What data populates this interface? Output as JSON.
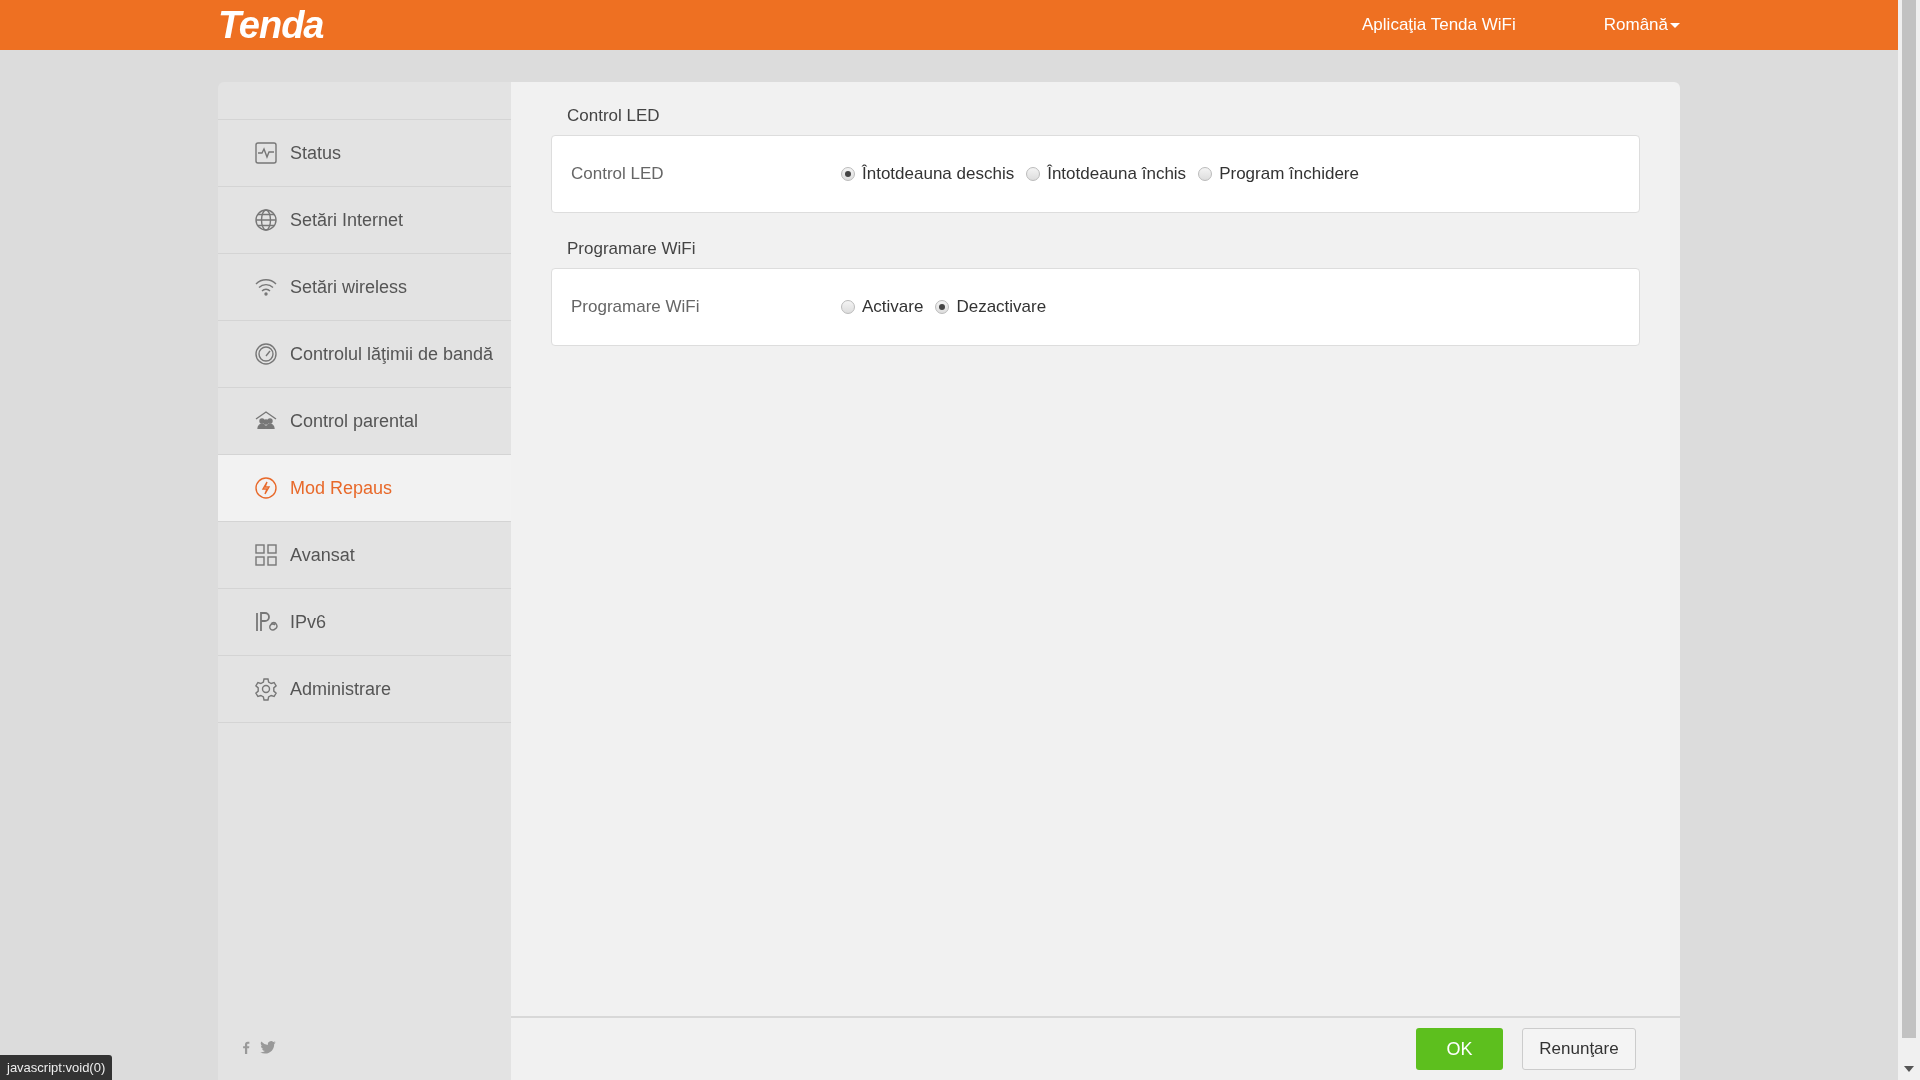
{
  "header": {
    "logo": "Tenda",
    "app_link": "Aplicaţia Tenda WiFi",
    "language": "Română"
  },
  "sidebar": {
    "items": [
      {
        "label": "Status",
        "selected": false
      },
      {
        "label": "Setări Internet",
        "selected": false
      },
      {
        "label": "Setări wireless",
        "selected": false
      },
      {
        "label": "Controlul lăţimii de bandă",
        "selected": false
      },
      {
        "label": "Control parental",
        "selected": false
      },
      {
        "label": "Mod Repaus",
        "selected": true
      },
      {
        "label": "Avansat",
        "selected": false
      },
      {
        "label": "IPv6",
        "selected": false
      },
      {
        "label": "Administrare",
        "selected": false
      }
    ]
  },
  "sections": [
    {
      "title": "Control LED",
      "label": "Control LED",
      "options": [
        {
          "label": "Întotdeauna deschis",
          "selected": true
        },
        {
          "label": "Întotdeauna închis",
          "selected": false
        },
        {
          "label": "Program închidere",
          "selected": false
        }
      ]
    },
    {
      "title": "Programare WiFi",
      "label": "Programare WiFi",
      "options": [
        {
          "label": "Activare",
          "selected": false
        },
        {
          "label": "Dezactivare",
          "selected": true
        }
      ]
    }
  ],
  "buttons": {
    "ok": "OK",
    "cancel": "Renunţare"
  },
  "status_bar": "javascript:void(0)"
}
